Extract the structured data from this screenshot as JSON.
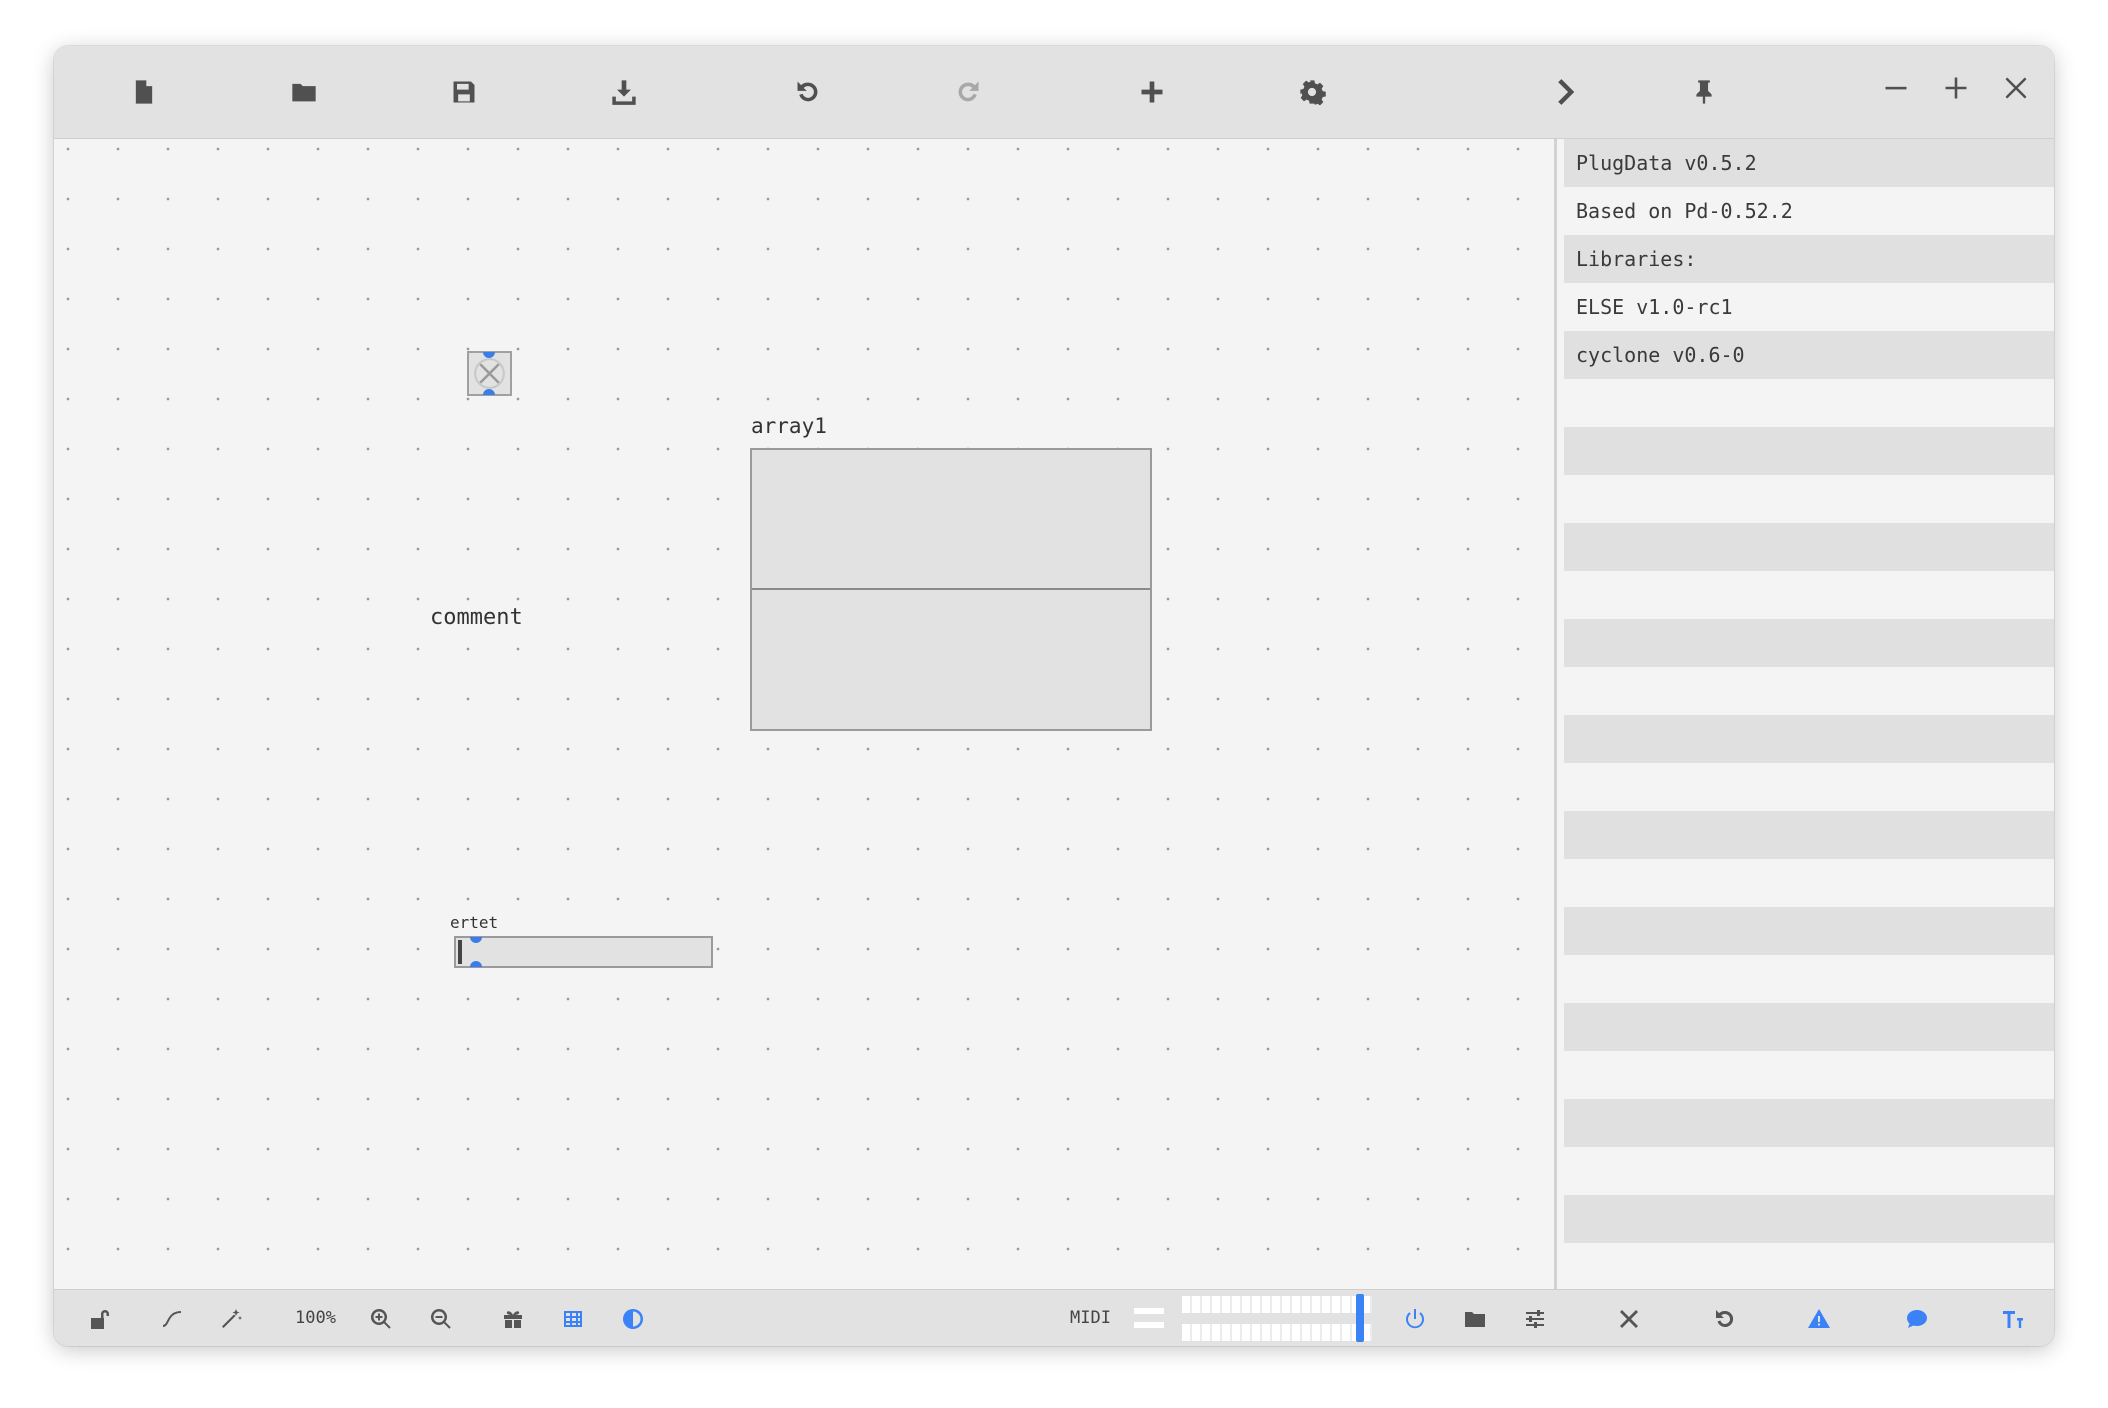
{
  "toolbar": {
    "buttons": [
      "new-file",
      "open-folder",
      "save",
      "save-as",
      "undo",
      "redo",
      "add-object",
      "settings",
      "toggle-sidebar",
      "pin"
    ]
  },
  "canvas": {
    "bang_label": "",
    "array_label": "array1",
    "comment_text": "comment",
    "slider_label": "ertet",
    "slider_value": 0.0
  },
  "sidebar": {
    "rows": [
      "PlugData v0.5.2",
      "Based on Pd-0.52.2",
      "Libraries:",
      "ELSE v1.0-rc1",
      "cyclone v0.6-0",
      "",
      "",
      "",
      "",
      "",
      "",
      "",
      "",
      "",
      "",
      "",
      "",
      "",
      "",
      "",
      "",
      "",
      "",
      ""
    ]
  },
  "statusbar": {
    "zoom": "100%",
    "midi_label": "MIDI"
  },
  "colors": {
    "accent": "#3b82f6",
    "toolbar_bg": "#e2e2e2",
    "canvas_bg": "#f4f4f4",
    "object_bg": "#e2e2e2",
    "object_border": "#9a9a9a"
  }
}
